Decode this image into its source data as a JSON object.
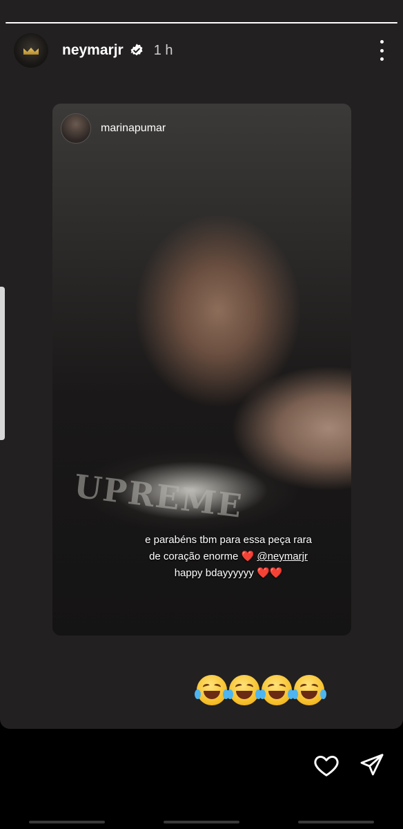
{
  "story": {
    "username": "neymarjr",
    "time": "1 h",
    "icons": {
      "verified": "verified-badge-icon",
      "more": "more-vertical-icon",
      "like": "heart-outline-icon",
      "send": "send-paper-plane-icon"
    }
  },
  "reshare": {
    "username": "marinapumar",
    "shirt_text": "UPREME",
    "caption": {
      "line1": "e parabéns tbm para essa peça rara",
      "line2_prefix": "de coração enorme",
      "line2_heart": "❤️",
      "mention": "@neymarjr",
      "line3": "happy bdayyyyyy",
      "line3_hearts": "❤️❤️"
    }
  },
  "emojis": {
    "count": 4,
    "name": "face-with-tears-of-joy"
  },
  "colors": {
    "background": "#232021",
    "heart": "#e53935"
  }
}
